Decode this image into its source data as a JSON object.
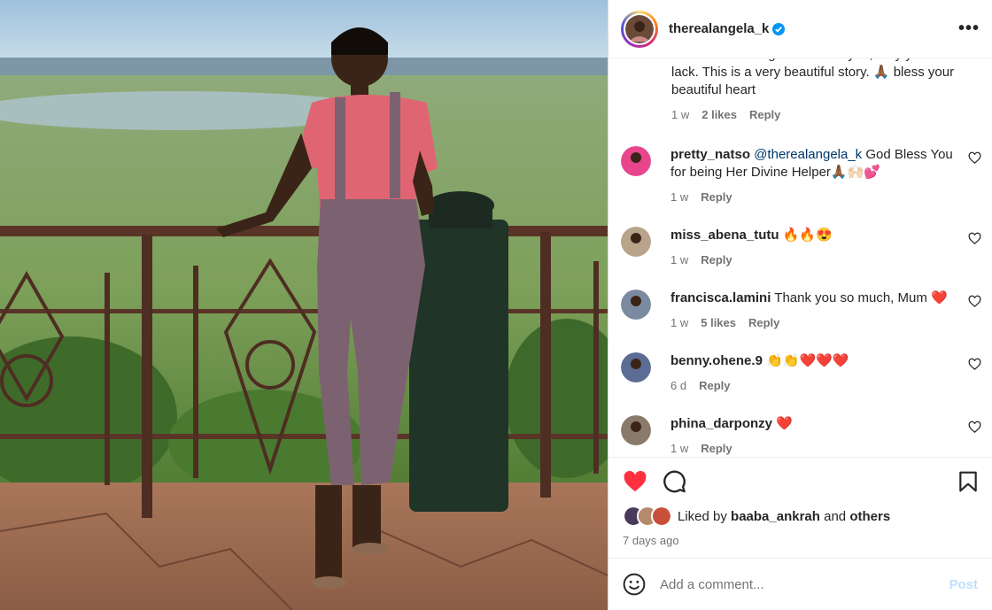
{
  "header": {
    "username": "therealangela_k",
    "more_label": "•••"
  },
  "top_caption": {
    "text": "God. For allowing God to use you, may you never lack. This is a very beautiful story. 🙏🏾 bless your beautiful heart",
    "time": "1 w",
    "likes": "2 likes",
    "reply": "Reply"
  },
  "comments": [
    {
      "user": "pretty_natso",
      "mention": "@therealangela_k",
      "text": " God Bless You for being Her Divine Helper🙏🏾🙌🏻💕",
      "time": "1 w",
      "likes": "",
      "reply": "Reply",
      "avatar_color": "#e7468d"
    },
    {
      "user": "miss_abena_tutu",
      "mention": "",
      "text": " 🔥🔥😍",
      "time": "1 w",
      "likes": "",
      "reply": "Reply",
      "avatar_color": "#b9a38a"
    },
    {
      "user": "francisca.lamini",
      "mention": "",
      "text": " Thank you so much, Mum ❤️",
      "time": "1 w",
      "likes": "5 likes",
      "reply": "Reply",
      "avatar_color": "#7a8aa0"
    },
    {
      "user": "benny.ohene.9",
      "mention": "",
      "text": " 👏👏❤️❤️❤️",
      "time": "6 d",
      "likes": "",
      "reply": "Reply",
      "avatar_color": "#5b6d95"
    },
    {
      "user": "phina_darponzy",
      "mention": "",
      "text": " ❤️",
      "time": "1 w",
      "likes": "",
      "reply": "Reply",
      "avatar_color": "#8a7a6a"
    }
  ],
  "likes": {
    "prefix": "Liked by ",
    "user": "baaba_ankrah",
    "mid": " and ",
    "others": "others"
  },
  "posted": "7 days ago",
  "add_comment": {
    "placeholder": "Add a comment...",
    "post_label": "Post"
  },
  "colors": {
    "like_red": "#ff3040",
    "link_blue": "#00376b",
    "post_disabled": "#c0dffd",
    "verified_blue": "#0095f6"
  }
}
